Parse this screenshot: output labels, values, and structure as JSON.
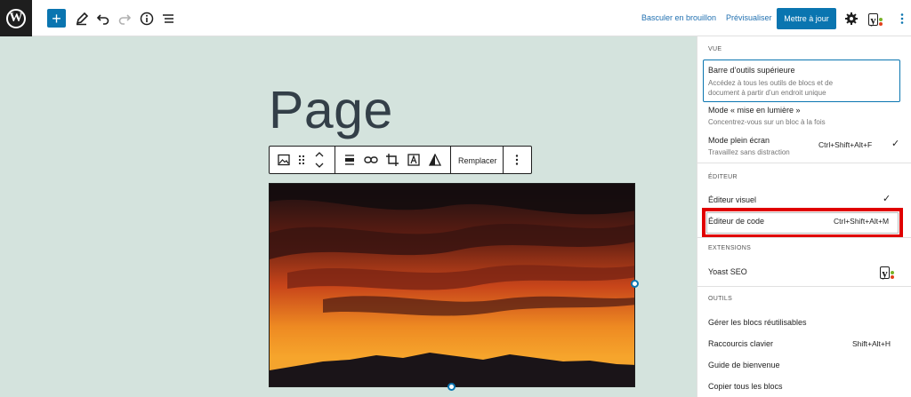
{
  "topbar": {
    "switch_to_draft": "Basculer en brouillon",
    "preview": "Prévisualiser",
    "update": "Mettre à jour"
  },
  "editor": {
    "page_title": "Page",
    "block_toolbar": {
      "replace": "Remplacer"
    }
  },
  "sidebar": {
    "view": {
      "heading": "VUE",
      "top_toolbar": {
        "label": "Barre d’outils supérieure",
        "desc_line1": "Accédez à tous les outils de blocs et de",
        "desc_line2": "document à partir d’un endroit unique"
      },
      "spotlight": {
        "label": "Mode « mise en lumière »",
        "desc": "Concentrez-vous sur un bloc à la fois"
      },
      "fullscreen": {
        "label": "Mode plein écran",
        "desc": "Travaillez sans distraction",
        "shortcut": "Ctrl+Shift+Alt+F"
      }
    },
    "editor": {
      "heading": "ÉDITEUR",
      "visual": "Éditeur visuel",
      "code": "Éditeur de code",
      "code_shortcut": "Ctrl+Shift+Alt+M"
    },
    "extensions": {
      "heading": "EXTENSIONS",
      "yoast": "Yoast SEO"
    },
    "tools": {
      "heading": "OUTILS",
      "reusable": "Gérer les blocs réutilisables",
      "shortcuts": "Raccourcis clavier",
      "shortcuts_key": "Shift+Alt+H",
      "welcome": "Guide de bienvenue",
      "copy_all": "Copier tous les blocs"
    }
  },
  "colors": {
    "accent": "#0a75b0",
    "canvas_bg": "#d4e3dd",
    "highlight": "#e00000"
  }
}
